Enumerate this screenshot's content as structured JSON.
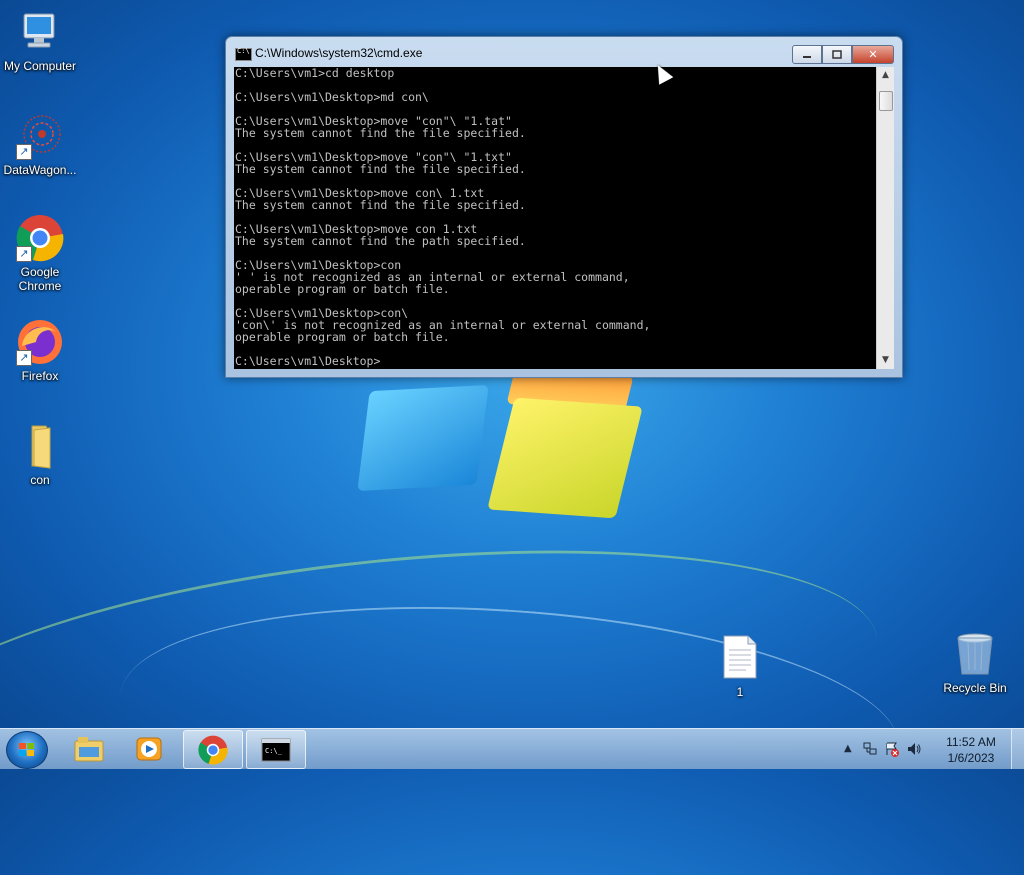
{
  "desktop": {
    "icons": [
      {
        "label": "My Computer",
        "icon": "computer-icon"
      },
      {
        "label": "DataWagon...",
        "icon": "datawagon-icon"
      },
      {
        "label": "Google Chrome",
        "icon": "chrome-icon"
      },
      {
        "label": "Firefox",
        "icon": "firefox-icon"
      },
      {
        "label": "con",
        "icon": "folder-icon"
      },
      {
        "label": "1",
        "icon": "text-file-icon"
      },
      {
        "label": "Recycle Bin",
        "icon": "recycle-bin-icon"
      }
    ]
  },
  "cmd_window": {
    "title": "C:\\Windows\\system32\\cmd.exe",
    "lines": [
      "C:\\Users\\vm1>cd desktop",
      "",
      "C:\\Users\\vm1\\Desktop>md con\\",
      "",
      "C:\\Users\\vm1\\Desktop>move \"con\"\\ \"1.tat\"",
      "The system cannot find the file specified.",
      "",
      "C:\\Users\\vm1\\Desktop>move \"con\"\\ \"1.txt\"",
      "The system cannot find the file specified.",
      "",
      "C:\\Users\\vm1\\Desktop>move con\\ 1.txt",
      "The system cannot find the file specified.",
      "",
      "C:\\Users\\vm1\\Desktop>move con 1.txt",
      "The system cannot find the path specified.",
      "",
      "C:\\Users\\vm1\\Desktop>con",
      "' ' is not recognized as an internal or external command,",
      "operable program or batch file.",
      "",
      "C:\\Users\\vm1\\Desktop>con\\",
      "'con\\' is not recognized as an internal or external command,",
      "operable program or batch file.",
      "",
      "C:\\Users\\vm1\\Desktop>"
    ]
  },
  "taskbar": {
    "clock_time": "11:52 AM",
    "clock_date": "1/6/2023",
    "pinned": [
      "explorer-icon",
      "media-player-icon",
      "chrome-icon",
      "cmd-icon"
    ],
    "active": "cmd-icon"
  }
}
